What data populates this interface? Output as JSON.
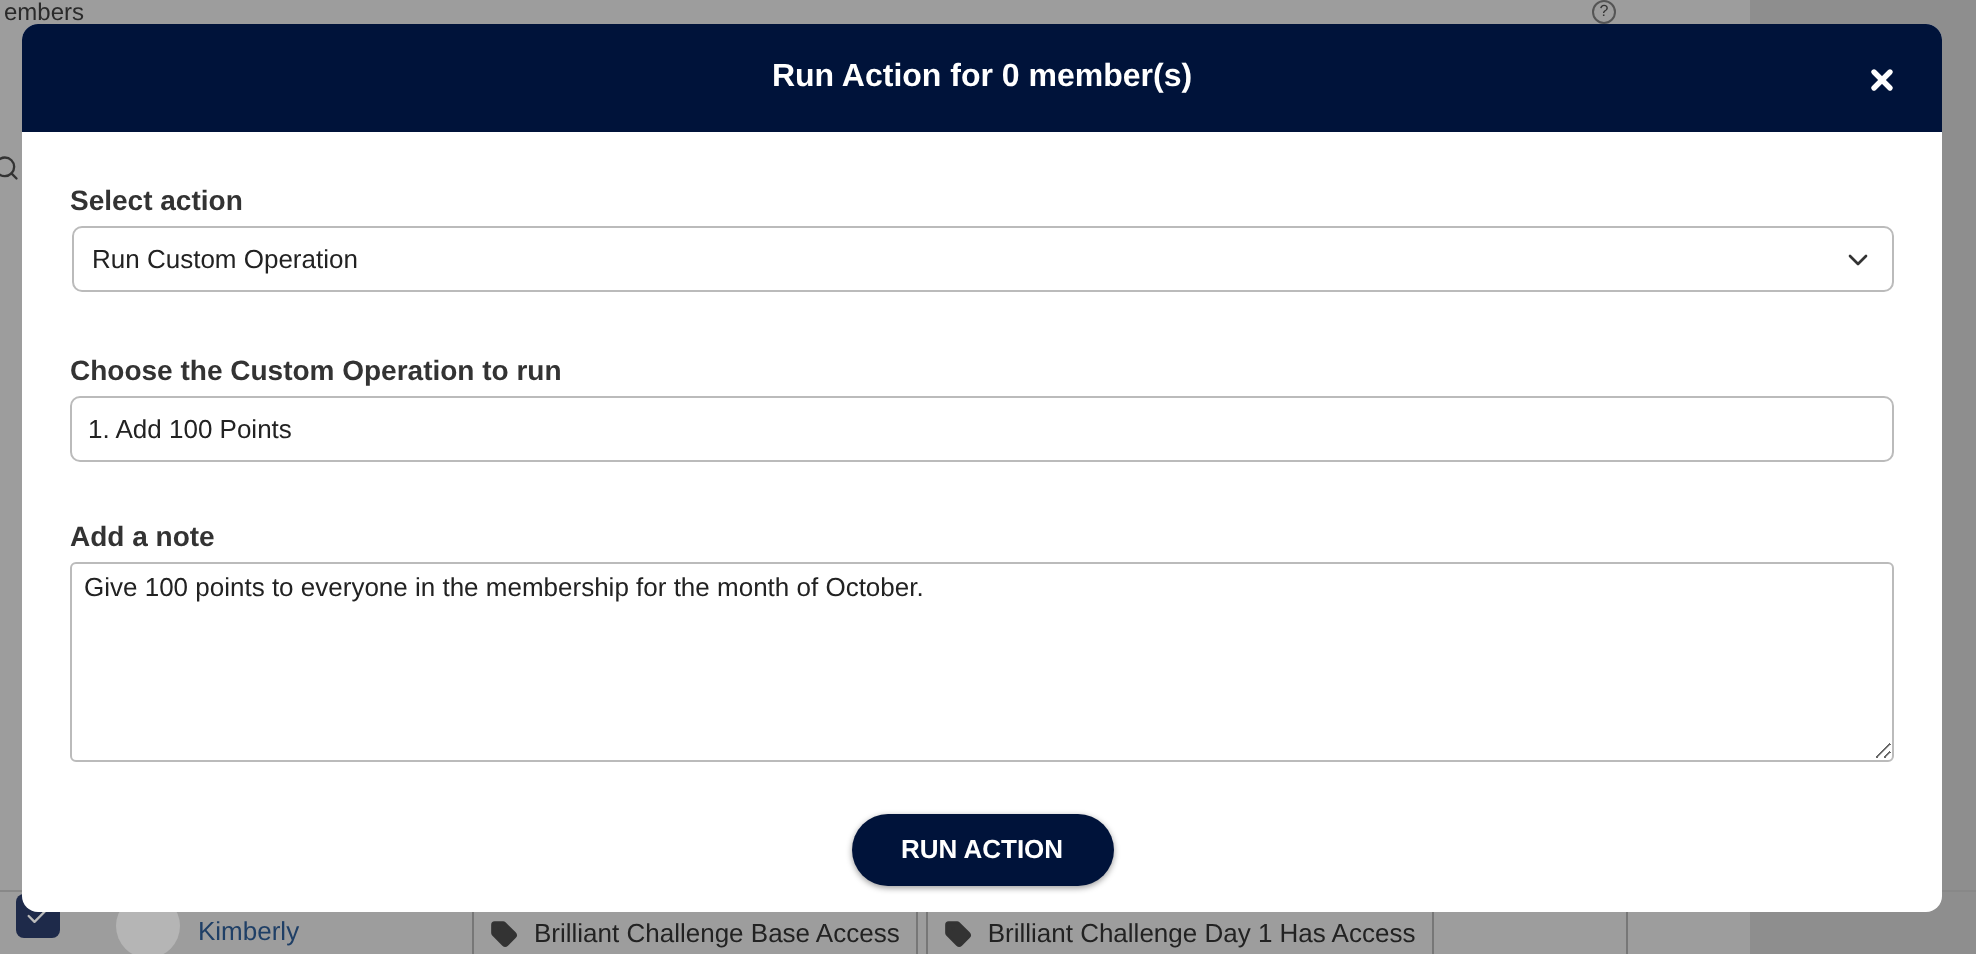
{
  "page": {
    "title": "embers",
    "help": "?",
    "member_name": "Kimberly",
    "tags": [
      "Brilliant Challenge Base Access",
      "Brilliant Challenge Day 1 Has Access"
    ],
    "row_checked": true
  },
  "modal": {
    "title": "Run Action for 0 member(s)",
    "fields": [
      {
        "kind": "select",
        "label": "Select action",
        "value": "Run Custom Operation"
      },
      {
        "kind": "input",
        "label": "Choose the Custom Operation to run",
        "value": "1. Add 100 Points"
      },
      {
        "kind": "textarea",
        "label": "Add a note",
        "value": "Give 100 points to everyone in the membership for the month of October."
      }
    ],
    "submit": "RUN ACTION"
  }
}
